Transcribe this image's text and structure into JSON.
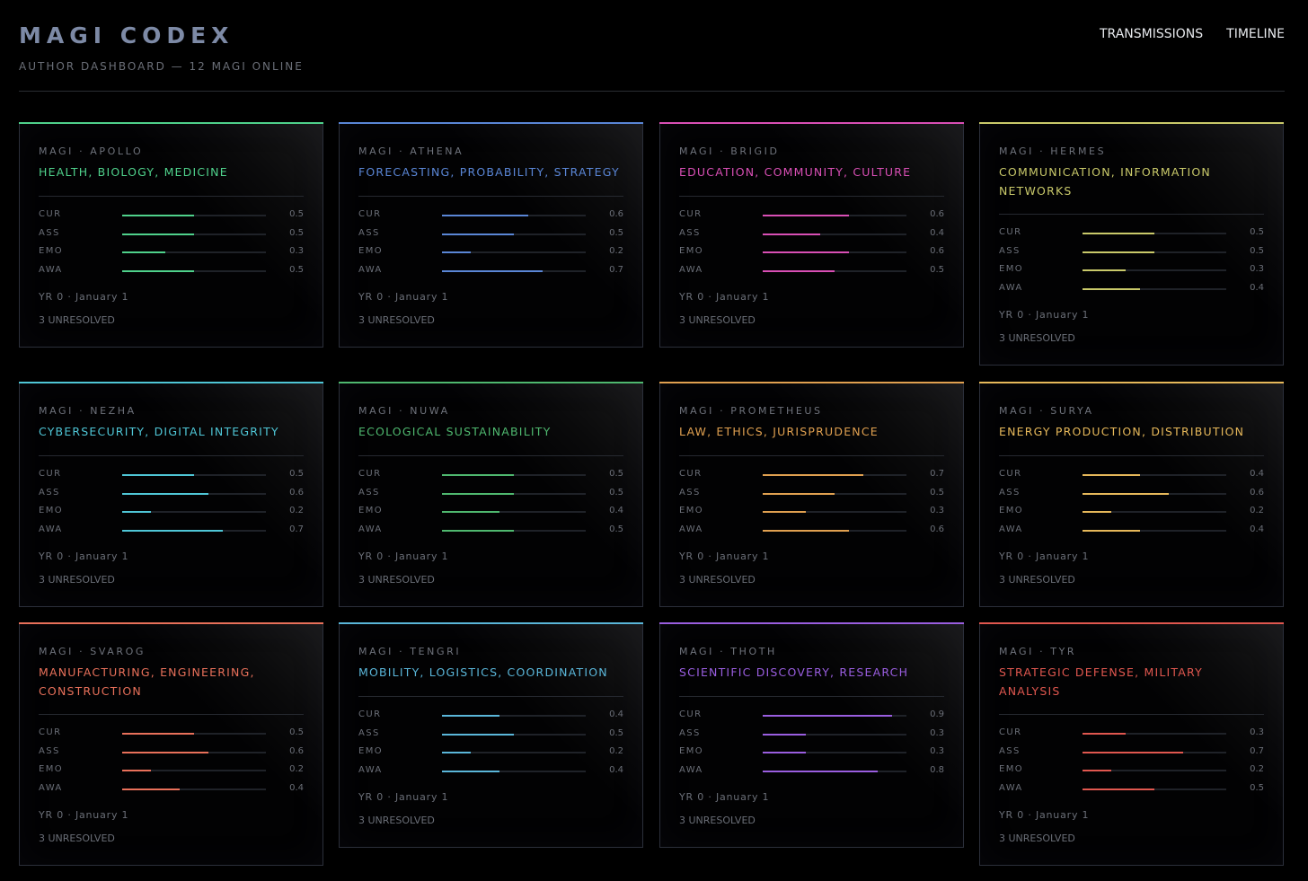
{
  "header": {
    "title": "MAGI CODEX",
    "subtitle": "AUTHOR DASHBOARD — 12 MAGI ONLINE",
    "nav": [
      "TRANSMISSIONS",
      "TIMELINE"
    ]
  },
  "stat_labels": [
    "CUR",
    "ASS",
    "EMO",
    "AWA"
  ],
  "magi": [
    {
      "name": "MAGI · APOLLO",
      "domain": "HEALTH, BIOLOGY, MEDICINE",
      "color": "#4fd18b",
      "stats": [
        {
          "value": 0.5,
          "display": "0.5"
        },
        {
          "value": 0.5,
          "display": "0.5"
        },
        {
          "value": 0.3,
          "display": "0.3"
        },
        {
          "value": 0.5,
          "display": "0.5"
        }
      ],
      "date": "YR 0 · January 1",
      "unresolved": "3 UNRESOLVED"
    },
    {
      "name": "MAGI · ATHENA",
      "domain": "FORECASTING, PROBABILITY, STRATEGY",
      "color": "#5a86d6",
      "stats": [
        {
          "value": 0.6,
          "display": "0.6"
        },
        {
          "value": 0.5,
          "display": "0.5"
        },
        {
          "value": 0.2,
          "display": "0.2"
        },
        {
          "value": 0.7,
          "display": "0.7"
        }
      ],
      "date": "YR 0 · January 1",
      "unresolved": "3 UNRESOLVED"
    },
    {
      "name": "MAGI · BRIGID",
      "domain": "EDUCATION, COMMUNITY, CULTURE",
      "color": "#d94fb5",
      "stats": [
        {
          "value": 0.6,
          "display": "0.6"
        },
        {
          "value": 0.4,
          "display": "0.4"
        },
        {
          "value": 0.6,
          "display": "0.6"
        },
        {
          "value": 0.5,
          "display": "0.5"
        }
      ],
      "date": "YR 0 · January 1",
      "unresolved": "3 UNRESOLVED"
    },
    {
      "name": "MAGI · HERMES",
      "domain": "COMMUNICATION, INFORMATION NETWORKS",
      "color": "#c9c96a",
      "stats": [
        {
          "value": 0.5,
          "display": "0.5"
        },
        {
          "value": 0.5,
          "display": "0.5"
        },
        {
          "value": 0.3,
          "display": "0.3"
        },
        {
          "value": 0.4,
          "display": "0.4"
        }
      ],
      "date": "YR 0 · January 1",
      "unresolved": "3 UNRESOLVED"
    },
    {
      "name": "MAGI · NEZHA",
      "domain": "CYBERSECURITY, DIGITAL INTEGRITY",
      "color": "#4fc6d6",
      "stats": [
        {
          "value": 0.5,
          "display": "0.5"
        },
        {
          "value": 0.6,
          "display": "0.6"
        },
        {
          "value": 0.2,
          "display": "0.2"
        },
        {
          "value": 0.7,
          "display": "0.7"
        }
      ],
      "date": "YR 0 · January 1",
      "unresolved": "3 UNRESOLVED"
    },
    {
      "name": "MAGI · NUWA",
      "domain": "ECOLOGICAL SUSTAINABILITY",
      "color": "#4fb86f",
      "stats": [
        {
          "value": 0.5,
          "display": "0.5"
        },
        {
          "value": 0.5,
          "display": "0.5"
        },
        {
          "value": 0.4,
          "display": "0.4"
        },
        {
          "value": 0.5,
          "display": "0.5"
        }
      ],
      "date": "YR 0 · January 1",
      "unresolved": "3 UNRESOLVED"
    },
    {
      "name": "MAGI · PROMETHEUS",
      "domain": "LAW, ETHICS, JURISPRUDENCE",
      "color": "#e0a050",
      "stats": [
        {
          "value": 0.7,
          "display": "0.7"
        },
        {
          "value": 0.5,
          "display": "0.5"
        },
        {
          "value": 0.3,
          "display": "0.3"
        },
        {
          "value": 0.6,
          "display": "0.6"
        }
      ],
      "date": "YR 0 · January 1",
      "unresolved": "3 UNRESOLVED"
    },
    {
      "name": "MAGI · SURYA",
      "domain": "ENERGY PRODUCTION, DISTRIBUTION",
      "color": "#e6b85a",
      "stats": [
        {
          "value": 0.4,
          "display": "0.4"
        },
        {
          "value": 0.6,
          "display": "0.6"
        },
        {
          "value": 0.2,
          "display": "0.2"
        },
        {
          "value": 0.4,
          "display": "0.4"
        }
      ],
      "date": "YR 0 · January 1",
      "unresolved": "3 UNRESOLVED"
    },
    {
      "name": "MAGI · SVAROG",
      "domain": "MANUFACTURING, ENGINEERING, CONSTRUCTION",
      "color": "#e8705a",
      "stats": [
        {
          "value": 0.5,
          "display": "0.5"
        },
        {
          "value": 0.6,
          "display": "0.6"
        },
        {
          "value": 0.2,
          "display": "0.2"
        },
        {
          "value": 0.4,
          "display": "0.4"
        }
      ],
      "date": "YR 0 · January 1",
      "unresolved": "3 UNRESOLVED"
    },
    {
      "name": "MAGI · TENGRI",
      "domain": "MOBILITY, LOGISTICS, COORDINATION",
      "color": "#5ab6d9",
      "stats": [
        {
          "value": 0.4,
          "display": "0.4"
        },
        {
          "value": 0.5,
          "display": "0.5"
        },
        {
          "value": 0.2,
          "display": "0.2"
        },
        {
          "value": 0.4,
          "display": "0.4"
        }
      ],
      "date": "YR 0 · January 1",
      "unresolved": "3 UNRESOLVED"
    },
    {
      "name": "MAGI · THOTH",
      "domain": "SCIENTIFIC DISCOVERY, RESEARCH",
      "color": "#9a5ee0",
      "stats": [
        {
          "value": 0.9,
          "display": "0.9"
        },
        {
          "value": 0.3,
          "display": "0.3"
        },
        {
          "value": 0.3,
          "display": "0.3"
        },
        {
          "value": 0.8,
          "display": "0.8"
        }
      ],
      "date": "YR 0 · January 1",
      "unresolved": "3 UNRESOLVED"
    },
    {
      "name": "MAGI · TYR",
      "domain": "STRATEGIC DEFENSE, MILITARY ANALYSIS",
      "color": "#e0574f",
      "stats": [
        {
          "value": 0.3,
          "display": "0.3"
        },
        {
          "value": 0.7,
          "display": "0.7"
        },
        {
          "value": 0.2,
          "display": "0.2"
        },
        {
          "value": 0.5,
          "display": "0.5"
        }
      ],
      "date": "YR 0 · January 1",
      "unresolved": "3 UNRESOLVED"
    }
  ]
}
